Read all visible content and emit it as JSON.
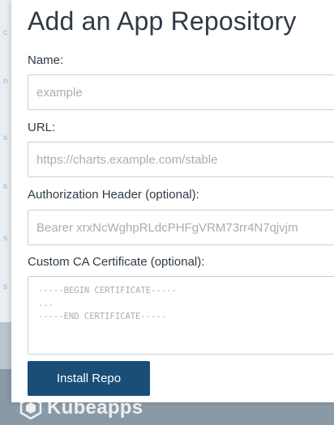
{
  "modal": {
    "title": "Add an App Repository",
    "name_label": "Name:",
    "name_placeholder": "example",
    "name_value": "",
    "url_label": "URL:",
    "url_placeholder": "https://charts.example.com/stable",
    "url_value": "",
    "auth_label": "Authorization Header (optional):",
    "auth_placeholder": "Bearer xrxNcWghpRLdcPHFgVRM73rr4N7qjvjm",
    "auth_value": "",
    "ca_label": "Custom CA Certificate (optional):",
    "ca_placeholder": "-----BEGIN CERTIFICATE-----\n...\n-----END CERTIFICATE-----",
    "install_label": "Install Repo"
  },
  "footer": {
    "logo_text": "Kubeapps"
  },
  "colors": {
    "primary_button": "#1a4e78",
    "title_text": "#2f3b45"
  }
}
